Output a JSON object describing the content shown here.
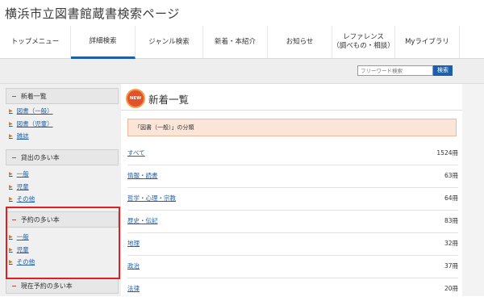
{
  "site": {
    "title": "横浜市立図書館蔵書検索ページ"
  },
  "nav": {
    "tabs": [
      {
        "label": "トップメニュー",
        "sub": ""
      },
      {
        "label": "詳細検索",
        "sub": ""
      },
      {
        "label": "ジャンル検索",
        "sub": ""
      },
      {
        "label": "新着・本紹介",
        "sub": ""
      },
      {
        "label": "お知らせ",
        "sub": ""
      },
      {
        "label": "レファレンス",
        "sub": "（調べもの・相談）"
      },
      {
        "label": "Myライブラリ",
        "sub": ""
      }
    ]
  },
  "search": {
    "placeholder": "フリーワード検索",
    "button_label": "検索"
  },
  "sidebar": {
    "sections": [
      {
        "title": "新着一覧",
        "items": [
          "図書（一般）",
          "図書（児童）",
          "雑誌"
        ]
      },
      {
        "title": "貸出の多い本",
        "items": [
          "一般",
          "児童",
          "その他"
        ]
      },
      {
        "title": "予約の多い本",
        "items": [
          "一般",
          "児童",
          "その他"
        ]
      },
      {
        "title": "現在予約の多い本",
        "items": []
      }
    ]
  },
  "main": {
    "badge": "NEW",
    "title": "新着一覧",
    "note": "「図書（一般）」の分類",
    "rows": [
      {
        "name": "すべて",
        "count": "1524冊"
      },
      {
        "name": "情報・読書",
        "count": "63冊"
      },
      {
        "name": "哲学・心理・宗教",
        "count": "64冊"
      },
      {
        "name": "歴史・伝記",
        "count": "83冊"
      },
      {
        "name": "地理",
        "count": "32冊"
      },
      {
        "name": "政治",
        "count": "37冊"
      },
      {
        "name": "法律",
        "count": "20冊"
      }
    ]
  },
  "colors": {
    "accent": "#1f5fa8",
    "highlight": "#e02020",
    "note_bg": "#fbe5d8"
  }
}
